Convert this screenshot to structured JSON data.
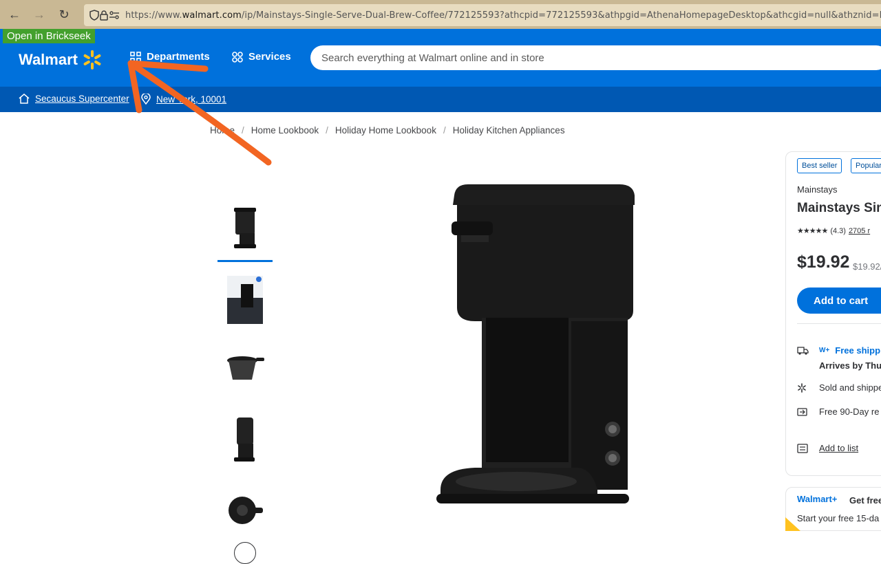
{
  "browser": {
    "url_prefix": "https://www.",
    "url_domain": "walmart.com",
    "url_path": "/ip/Mainstays-Single-Serve-Dual-Brew-Coffee/772125593?athcpid=772125593&athpgid=AthenaHomepageDesktop&athcgid=null&athznid=BestSe"
  },
  "extension_label": "Open in Brickseek",
  "header": {
    "logo_text": "Walmart",
    "departments_label": "Departments",
    "services_label": "Services",
    "search_placeholder": "Search everything at Walmart online and in store",
    "store_label": "Secaucus Supercenter",
    "location_label": "New York, 10001"
  },
  "breadcrumbs": [
    "Home",
    "Home Lookbook",
    "Holiday Home Lookbook",
    "Holiday Kitchen Appliances"
  ],
  "product": {
    "badges": [
      "Best seller",
      "Popular"
    ],
    "brand": "Mainstays",
    "title": "Mainstays Sing",
    "rating_text": "(4.3)",
    "reviews_text": "2705 r",
    "price": "$19.92",
    "unit_price": "$19.92/",
    "add_to_cart": "Add to cart"
  },
  "fulfillment": {
    "wplus_mini": "W+",
    "free_shipping": "Free shipp",
    "arrives": "Arrives by Thu,",
    "sold_by": "Sold and shippe",
    "returns": "Free 90-Day re",
    "add_to_list": "Add to list"
  },
  "promo": {
    "logo": "Walmart+",
    "title": "Get free",
    "subtitle": "Start your free 15-da"
  },
  "colors": {
    "walmart_blue": "#0071dc",
    "subheader_blue": "#0058b3",
    "spark_yellow": "#ffc220",
    "annotation_orange": "#f26522",
    "brickseek_green": "#43a02d"
  }
}
